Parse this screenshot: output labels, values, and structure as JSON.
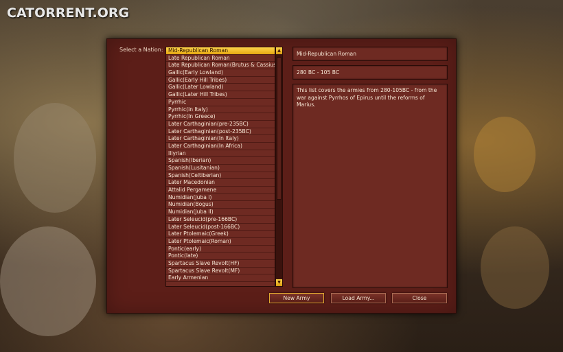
{
  "watermark": "CATORRENT.ORG",
  "dialog": {
    "nation_label": "Select a Nation:",
    "nations": [
      "Mid-Republican Roman",
      "Late Republican Roman",
      "Late Republican Roman(Brutus & Cassius)",
      "Gallic(Early Lowland)",
      "Gallic(Early Hill Tribes)",
      "Gallic(Later Lowland)",
      "Gallic(Later Hill Tribes)",
      "Pyrrhic",
      "Pyrrhic(in Italy)",
      "Pyrrhic(In Greece)",
      "Later Carthaginian(pre-235BC)",
      "Later Carthaginian(post-235BC)",
      "Later Carthaginian(In Italy)",
      "Later Carthaginian(In Africa)",
      "Illyrian",
      "Spanish(Iberian)",
      "Spanish(Lusitanian)",
      "Spanish(Celtiberian)",
      "Later Macedonian",
      "Attalid Pergamene",
      "Numidian(Juba I)",
      "Numidian(Bogus)",
      "Numidian(Juba II)",
      "Later Seleucid(pre-166BC)",
      "Later Seleucid(post-166BC)",
      "Later Ptolemaic(Greek)",
      "Later Ptolemaic(Roman)",
      "Pontic(early)",
      "Pontic(late)",
      "Spartacus Slave Revolt(HF)",
      "Spartacus Slave Revolt(MF)",
      "Early Armenian"
    ],
    "selected_index": 0,
    "info_title": "Mid-Republican Roman",
    "info_period": "280 BC - 105 BC",
    "info_description": "This list covers the armies from 280-105BC - from the war against Pyrrhos of Epirus until the reforms of Marius.",
    "buttons": {
      "new_army": "New Army",
      "load_army": "Load Army...",
      "close": "Close"
    },
    "scroll_up_icon": "triangle-up",
    "scroll_down_icon": "triangle-down"
  },
  "colors": {
    "dialog_bg": "#5c1e18",
    "list_bg": "#6e2a22",
    "selected_bg": "#ffd44a",
    "text": "#f6e6d4"
  }
}
